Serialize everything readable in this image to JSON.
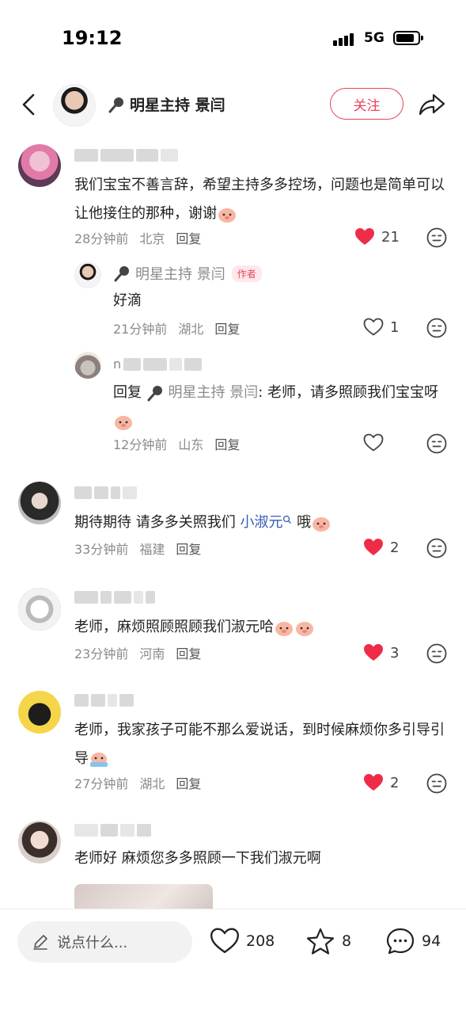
{
  "status": {
    "time": "19:12",
    "network": "5G"
  },
  "header": {
    "icon_mic": "microphone-icon",
    "title": "明星主持 景闫",
    "follow_label": "关注"
  },
  "comments": [
    {
      "text": "我们宝宝不善言辞，希望主持多多控场，问题也是简单可以让他接住的那种，谢谢",
      "time": "28分钟前",
      "location": "北京",
      "reply_label": "回复",
      "likes": "21",
      "liked": true,
      "replies": [
        {
          "name": "明星主持 景闫",
          "badge": "作者",
          "text": "好滴",
          "time": "21分钟前",
          "location": "湖北",
          "reply_label": "回复",
          "likes": "1",
          "liked": false
        },
        {
          "name_visible": "n",
          "reply_prefix": "回复",
          "reply_to": "明星主持 景闫",
          "text": ": 老师，请多照顾我们宝宝呀",
          "time": "12分钟前",
          "location": "山东",
          "reply_label": "回复",
          "likes": "",
          "liked": false
        }
      ]
    },
    {
      "text_before": "期待期待 请多多关照我们 ",
      "mention": "小淑元",
      "text_after": " 哦",
      "time": "33分钟前",
      "location": "福建",
      "reply_label": "回复",
      "likes": "2",
      "liked": true
    },
    {
      "text": "老师，麻烦照顾照顾我们淑元哈",
      "time": "23分钟前",
      "location": "河南",
      "reply_label": "回复",
      "likes": "3",
      "liked": true
    },
    {
      "text": "老师，我家孩子可能不那么爱说话，到时候麻烦你多引导引导",
      "time": "27分钟前",
      "location": "湖北",
      "reply_label": "回复",
      "likes": "2",
      "liked": true
    },
    {
      "text": "老师好  麻烦您多多照顾一下我们淑元啊"
    }
  ],
  "bottom": {
    "input_placeholder": "说点什么...",
    "likes": "208",
    "favorites": "8",
    "comments": "94"
  },
  "colors": {
    "accent": "#e8435d",
    "mention": "#3a5bb5",
    "meta": "#8a8a8a"
  }
}
